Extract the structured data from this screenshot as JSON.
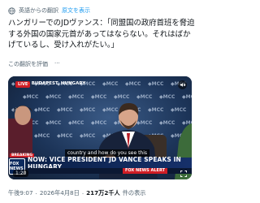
{
  "translation": {
    "notice": "英語からの翻訳",
    "show_original": "原文を表示"
  },
  "post": {
    "text": "ハンガリーでのJDヴァンス：「同盟国の政府首班を脅迫する外国の国家元首があってはならない。それはばかげているし、受け入れがたい。」"
  },
  "rate_translation": "この翻訳を評価",
  "video": {
    "live_tag": "LIVE",
    "location": "BUDAPEST, HUNGARY",
    "caption": "country and how do you see this",
    "breaking": "BREAKING",
    "headline": "NOW: VICE PRESIDENT JD VANCE SPEAKS IN HUNGARY",
    "alert": "FOX NEWS ALERT",
    "network": "FOX NEWS",
    "time": "1:20",
    "wall_logo": "MCC"
  },
  "meta": {
    "time": "午後9:07",
    "date": "2026年4月8日",
    "sep": "·",
    "views_count": "217万2千人",
    "views_suffix": "件の表示"
  },
  "colors": {
    "accent": "#1d9bf0",
    "muted": "#536471",
    "breaking_red": "#cf1d25"
  }
}
